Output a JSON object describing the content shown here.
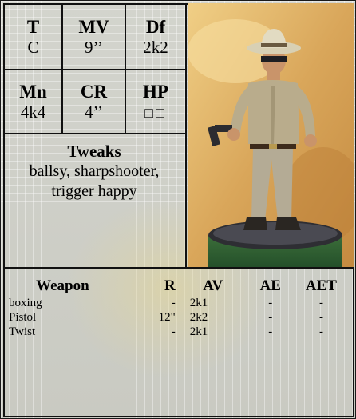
{
  "stats": {
    "t": {
      "label": "T",
      "value": "C"
    },
    "mv": {
      "label": "MV",
      "value": "9’’"
    },
    "df": {
      "label": "Df",
      "value": "2k2"
    },
    "mn": {
      "label": "Mn",
      "value": "4k4"
    },
    "cr": {
      "label": "CR",
      "value": "4’’"
    },
    "hp": {
      "label": "HP",
      "value": "□□"
    }
  },
  "tweaks": {
    "title": "Tweaks",
    "line1": "ballsy, sharpshooter,",
    "line2": "trigger happy"
  },
  "weapons": {
    "headers": [
      "Weapon",
      "R",
      "AV",
      "AE",
      "AET"
    ],
    "rows": [
      [
        "boxing",
        "-",
        "2k1",
        "-",
        "-"
      ],
      [
        "Pistol",
        "12\"",
        "2k2",
        "-",
        "-"
      ],
      [
        "Twist",
        "-",
        "2k1",
        "-",
        "-"
      ]
    ]
  },
  "colors": {
    "border": "#111111",
    "card": "#cfcfc8",
    "watermark": "#e4d696"
  }
}
